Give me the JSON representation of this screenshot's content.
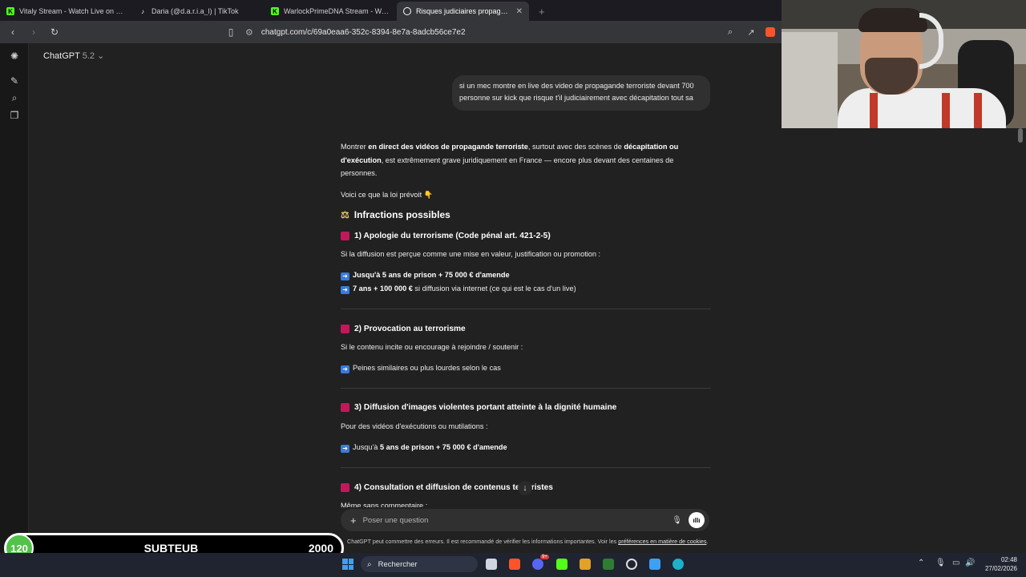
{
  "browser": {
    "tabs": [
      {
        "title": "Vitaly Stream - Watch Live on Kick",
        "icon": "kick-icon",
        "color": "#53fc18"
      },
      {
        "title": "Daria (@d.a.r.i.a_l) | TikTok",
        "icon": "tiktok-icon",
        "color": "#ffffff"
      },
      {
        "title": "WarlockPrimeDNA Stream - Watch Li",
        "icon": "kick-icon",
        "color": "#53fc18"
      },
      {
        "title": "Risques judiciaires propagande",
        "icon": "chatgpt-icon",
        "color": "#ffffff",
        "active": true
      }
    ],
    "url": "chatgpt.com/c/69a0eaa6-352c-8394-8e7a-8adcb56ce7e2"
  },
  "app": {
    "name": "ChatGPT",
    "version": "5.2"
  },
  "chat": {
    "user_message": "si un mec montre en live des video de propagande terroriste devant 700 personne sur kick que risque t'il judiciairement avec décapitation tout sa",
    "intro_parts": [
      "Montrer ",
      "en direct des vidéos de propagande terroriste",
      ", surtout avec des scènes de ",
      "décapitation ou d'exécution",
      ", est extrêmement grave juridiquement en France — encore plus devant des centaines de personnes."
    ],
    "law_intro": "Voici ce que la loi prévoit 👇",
    "section_heading": "Infractions possibles",
    "sec1_title": "1) Apologie du terrorisme (Code pénal art. 421-2-5)",
    "sec1_desc": "Si la diffusion est perçue comme une mise en valeur, justification ou promotion :",
    "sec1_b1": "Jusqu'à 5 ans de prison + 75 000 € d'amende",
    "sec1_b2_bold": "7 ans + 100 000 €",
    "sec1_b2_rest": " si diffusion via internet (ce qui est le cas d'un live)",
    "sec2_title": "2) Provocation au terrorisme",
    "sec2_desc": "Si le contenu incite ou encourage à rejoindre / soutenir :",
    "sec2_b1": "Peines similaires ou plus lourdes selon le cas",
    "sec3_title": "3) Diffusion d'images violentes portant atteinte à la dignité humaine",
    "sec3_desc": "Pour des vidéos d'exécutions ou mutilations :",
    "sec3_b1_pre": "Jusqu'à ",
    "sec3_b1_bold": "5 ans de prison + 75 000 € d'amende",
    "sec4_title": "4) Consultation et diffusion de contenus terroristes",
    "sec4_desc": "Même sans commentaire :"
  },
  "composer": {
    "placeholder": "Poser une question",
    "disclaimer": "ChatGPT peut commettre des erreurs. Il est recommandé de vérifier les informations importantes. Voir les ",
    "disclaimer_link": "préférences en matière de cookies",
    "disclaimer_end": "."
  },
  "overlay": {
    "current": "120",
    "label": "SUBTEUB",
    "goal": "2000"
  },
  "taskbar": {
    "search": "Rechercher",
    "time": "02:48",
    "date": "27/02/2026",
    "badge": "9+"
  },
  "colors": {
    "accent_square": "#c2185b",
    "arrow_blue": "#3b7bd8",
    "subgoal_green": "#53c24a"
  }
}
